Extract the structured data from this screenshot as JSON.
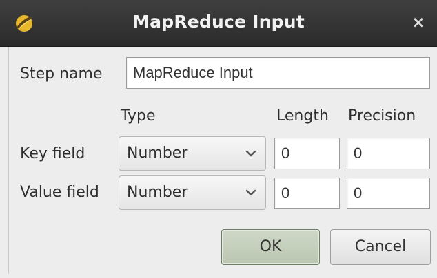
{
  "window": {
    "title": "MapReduce Input",
    "close_symbol": "×",
    "app_icon": "pentaho-kettle-icon",
    "accent_color": "#b8c5ad"
  },
  "form": {
    "step_name_label": "Step name",
    "step_name_value": "MapReduce Input",
    "headers": {
      "type": "Type",
      "length": "Length",
      "precision": "Precision"
    },
    "rows": [
      {
        "label": "Key field",
        "type": "Number",
        "length": "0",
        "precision": "0"
      },
      {
        "label": "Value field",
        "type": "Number",
        "length": "0",
        "precision": "0"
      }
    ]
  },
  "buttons": {
    "ok": "OK",
    "cancel": "Cancel"
  }
}
